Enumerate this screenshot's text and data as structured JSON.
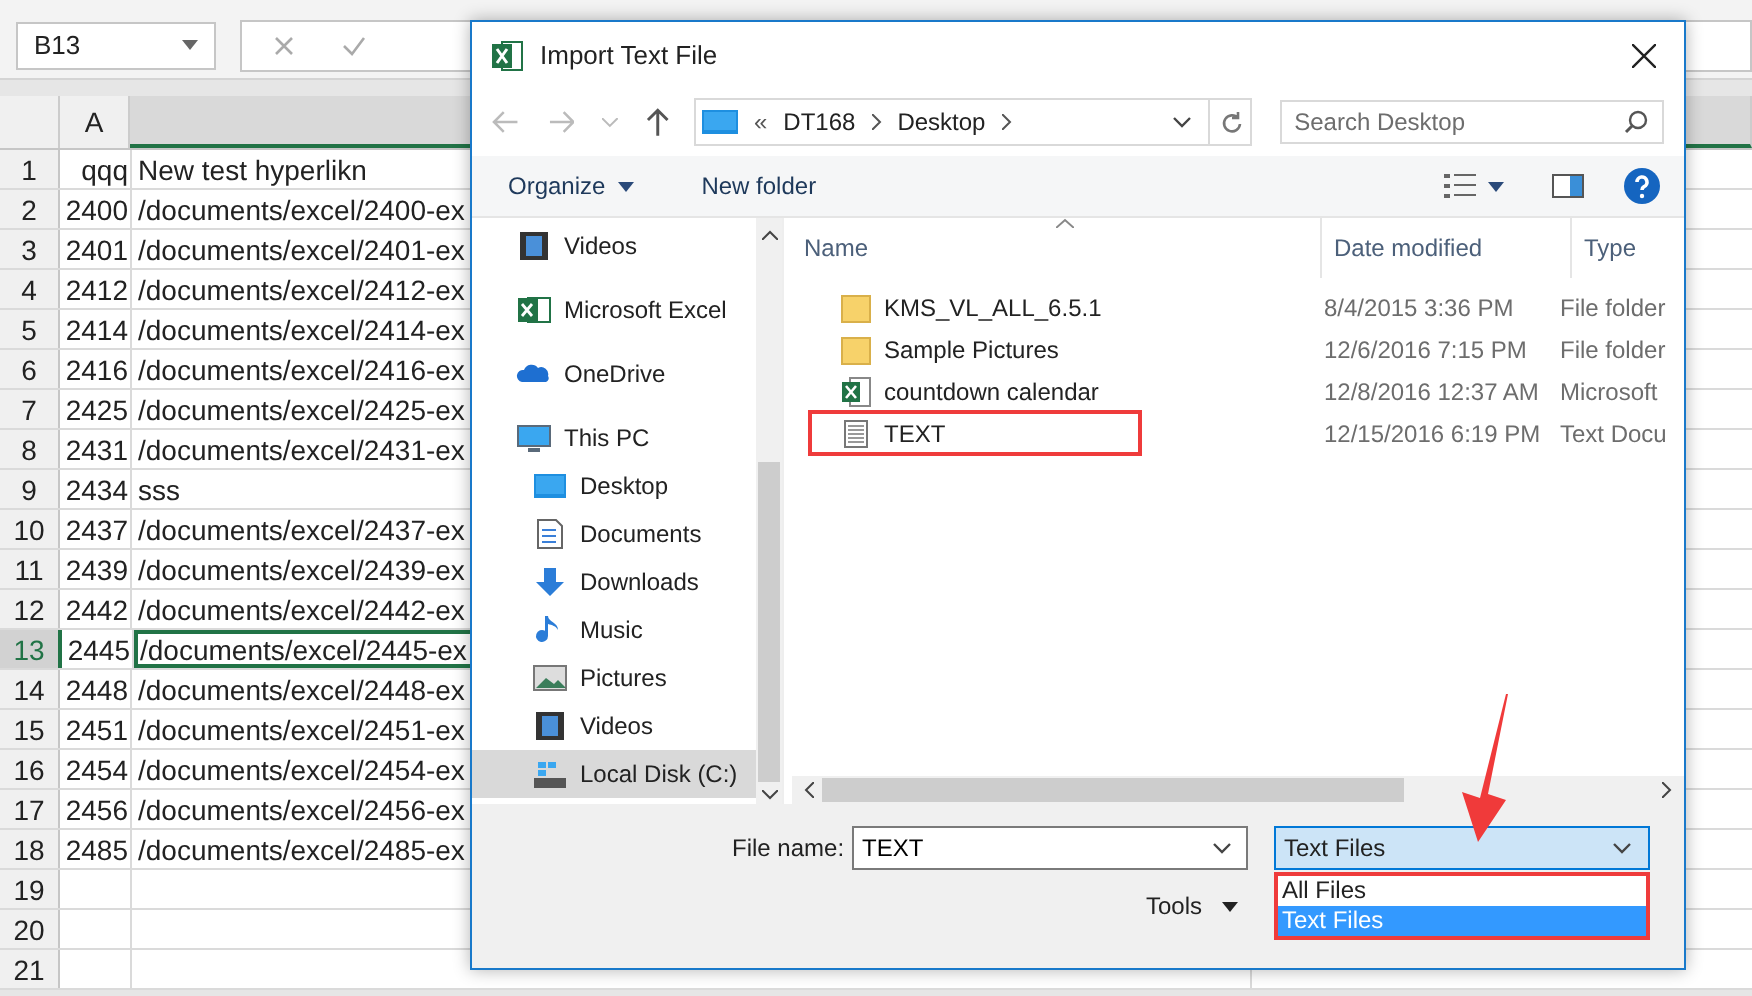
{
  "sheet": {
    "name_box": "B13",
    "column_a": "A",
    "rows": [
      {
        "num": "1",
        "a": "qqq",
        "b": "New test hyperlikn",
        "selected": false
      },
      {
        "num": "2",
        "a": "2400",
        "b": "/documents/excel/2400-ex",
        "selected": false
      },
      {
        "num": "3",
        "a": "2401",
        "b": "/documents/excel/2401-ex",
        "selected": false
      },
      {
        "num": "4",
        "a": "2412",
        "b": "/documents/excel/2412-ex",
        "selected": false
      },
      {
        "num": "5",
        "a": "2414",
        "b": "/documents/excel/2414-ex",
        "selected": false
      },
      {
        "num": "6",
        "a": "2416",
        "b": "/documents/excel/2416-ex",
        "selected": false
      },
      {
        "num": "7",
        "a": "2425",
        "b": "/documents/excel/2425-ex",
        "selected": false
      },
      {
        "num": "8",
        "a": "2431",
        "b": "/documents/excel/2431-ex",
        "selected": false
      },
      {
        "num": "9",
        "a": "2434",
        "b": "sss",
        "selected": false
      },
      {
        "num": "10",
        "a": "2437",
        "b": "/documents/excel/2437-ex",
        "selected": false
      },
      {
        "num": "11",
        "a": "2439",
        "b": "/documents/excel/2439-ex",
        "selected": false
      },
      {
        "num": "12",
        "a": "2442",
        "b": "/documents/excel/2442-ex",
        "selected": false
      },
      {
        "num": "13",
        "a": "2445",
        "b": "/documents/excel/2445-ex",
        "selected": true
      },
      {
        "num": "14",
        "a": "2448",
        "b": "/documents/excel/2448-ex",
        "selected": false
      },
      {
        "num": "15",
        "a": "2451",
        "b": "/documents/excel/2451-ex",
        "selected": false
      },
      {
        "num": "16",
        "a": "2454",
        "b": "/documents/excel/2454-ex",
        "selected": false
      },
      {
        "num": "17",
        "a": "2456",
        "b": "/documents/excel/2456-ex",
        "selected": false
      },
      {
        "num": "18",
        "a": "2485",
        "b": "/documents/excel/2485-ex",
        "selected": false
      },
      {
        "num": "19",
        "a": "",
        "b": "",
        "selected": false
      },
      {
        "num": "20",
        "a": "",
        "b": "",
        "selected": false
      },
      {
        "num": "21",
        "a": "",
        "b": "",
        "selected": false
      }
    ]
  },
  "dialog": {
    "title": "Import Text File",
    "path": [
      "«",
      "DT168",
      "Desktop"
    ],
    "search": {
      "placeholder": "Search Desktop"
    },
    "toolbar": {
      "organize": "Organize",
      "new_folder": "New folder"
    },
    "sidebar": [
      {
        "label": "Videos",
        "kind": "videos",
        "selected": false
      },
      {
        "label": "Microsoft Excel",
        "kind": "excel",
        "selected": false
      },
      {
        "label": "OneDrive",
        "kind": "cloud",
        "selected": false
      },
      {
        "label": "This PC",
        "kind": "pc",
        "selected": false,
        "children": [
          {
            "label": "Desktop",
            "kind": "desktop",
            "selected": false
          },
          {
            "label": "Documents",
            "kind": "documents",
            "selected": false
          },
          {
            "label": "Downloads",
            "kind": "downloads",
            "selected": false
          },
          {
            "label": "Music",
            "kind": "music",
            "selected": false
          },
          {
            "label": "Pictures",
            "kind": "pictures",
            "selected": false
          },
          {
            "label": "Videos",
            "kind": "videos",
            "selected": false
          },
          {
            "label": "Local Disk (C:)",
            "kind": "disk",
            "selected": true
          }
        ]
      }
    ],
    "columns": [
      "Name",
      "Date modified",
      "Type"
    ],
    "files": [
      {
        "name": "KMS_VL_ALL_6.5.1",
        "date": "8/4/2015 3:36 PM",
        "type": "File folder",
        "kind": "folder",
        "highlighted": false
      },
      {
        "name": "Sample Pictures",
        "date": "12/6/2016 7:15 PM",
        "type": "File folder",
        "kind": "folder",
        "highlighted": false
      },
      {
        "name": "countdown calendar",
        "date": "12/8/2016 12:37 AM",
        "type": "Microsoft",
        "kind": "excel",
        "highlighted": false
      },
      {
        "name": "TEXT",
        "date": "12/15/2016 6:19 PM",
        "type": "Text Docu",
        "kind": "text",
        "highlighted": true
      }
    ],
    "file_name": {
      "label": "File name:",
      "value": "TEXT"
    },
    "file_type": {
      "value": "Text Files",
      "options": [
        {
          "label": "All Files",
          "selected": false
        },
        {
          "label": "Text Files",
          "selected": true
        }
      ],
      "highlighted": true
    },
    "tools": "Tools"
  }
}
